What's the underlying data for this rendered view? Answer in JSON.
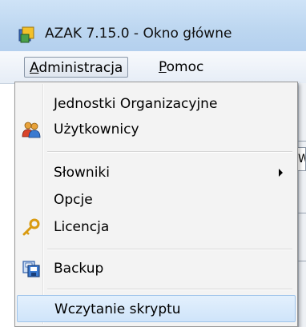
{
  "window": {
    "title": "AZAK 7.15.0 - Okno główne",
    "icon": "app-icon"
  },
  "menubar": {
    "items": [
      {
        "label": "Administracja",
        "mnemonic": "A",
        "rest": "dministracja",
        "active": true
      },
      {
        "label": "Pomoc",
        "mnemonic": "P",
        "rest": "omoc",
        "active": false
      }
    ]
  },
  "dropdown": {
    "items": [
      {
        "label": "Jednostki Organizacyjne",
        "icon": null
      },
      {
        "label": "Użytkownicy",
        "icon": "users-icon"
      },
      {
        "label": "Słowniki",
        "icon": null,
        "submenu": true
      },
      {
        "label": "Opcje",
        "icon": null
      },
      {
        "label": "Licencja",
        "icon": "key-icon"
      },
      {
        "label": "Backup",
        "icon": "backup-icon"
      },
      {
        "label": "Wczytanie skryptu",
        "icon": null,
        "highlighted": true
      }
    ]
  },
  "background": {
    "tab_fragment": "W"
  },
  "colors": {
    "highlight": "#cfe4fa",
    "titlebar": "#bcd6f0"
  }
}
